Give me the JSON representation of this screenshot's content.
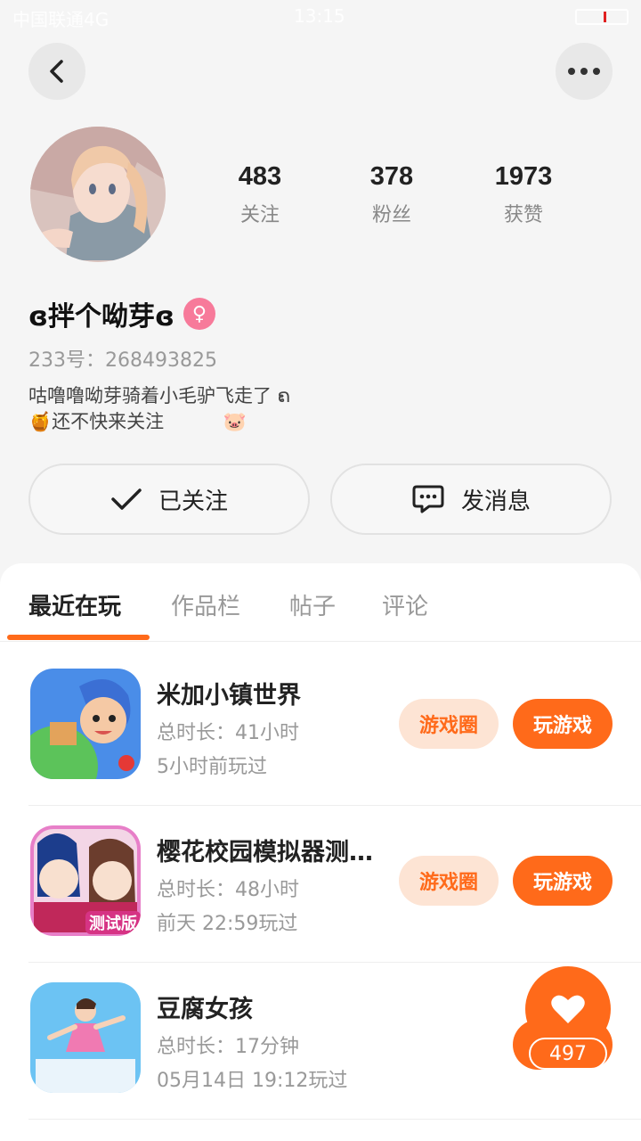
{
  "status_bar": {
    "carrier": "中国联通4G",
    "time": "13:15"
  },
  "profile": {
    "stats": [
      {
        "value": "483",
        "label": "关注"
      },
      {
        "value": "378",
        "label": "粉丝"
      },
      {
        "value": "1973",
        "label": "获赞"
      }
    ],
    "username": "ɞ拌个呦芽ɞ",
    "gender_symbol": "♀",
    "uid": "233号：268493825",
    "bio": "咕噜噜呦芽骑着小毛驴飞走了 ຄ\n🍯还不快来关注          🐷"
  },
  "actions": {
    "follow": "已关注",
    "message": "发消息"
  },
  "tabs": [
    {
      "label": "最近在玩",
      "active": true
    },
    {
      "label": "作品栏",
      "active": false
    },
    {
      "label": "帖子",
      "active": false
    },
    {
      "label": "评论",
      "active": false
    }
  ],
  "games": [
    {
      "title": "米加小镇世界",
      "duration": "总时长：41小时",
      "last_played": "5小时前玩过",
      "circle_label": "游戏圈",
      "play_label": "玩游戏"
    },
    {
      "title": "樱花校园模拟器测试版",
      "duration": "总时长：48小时",
      "last_played": "前天 22:59玩过",
      "circle_label": "游戏圈",
      "play_label": "玩游戏",
      "icon_badge": "测试版"
    },
    {
      "title": "豆腐女孩",
      "duration": "总时长：17分钟",
      "last_played": "05月14日 19:12玩过"
    }
  ],
  "like_fab": {
    "count": "497"
  },
  "colors": {
    "accent": "#ff6a1a",
    "accent_light": "#fde4d4",
    "gender": "#f77a9a"
  }
}
